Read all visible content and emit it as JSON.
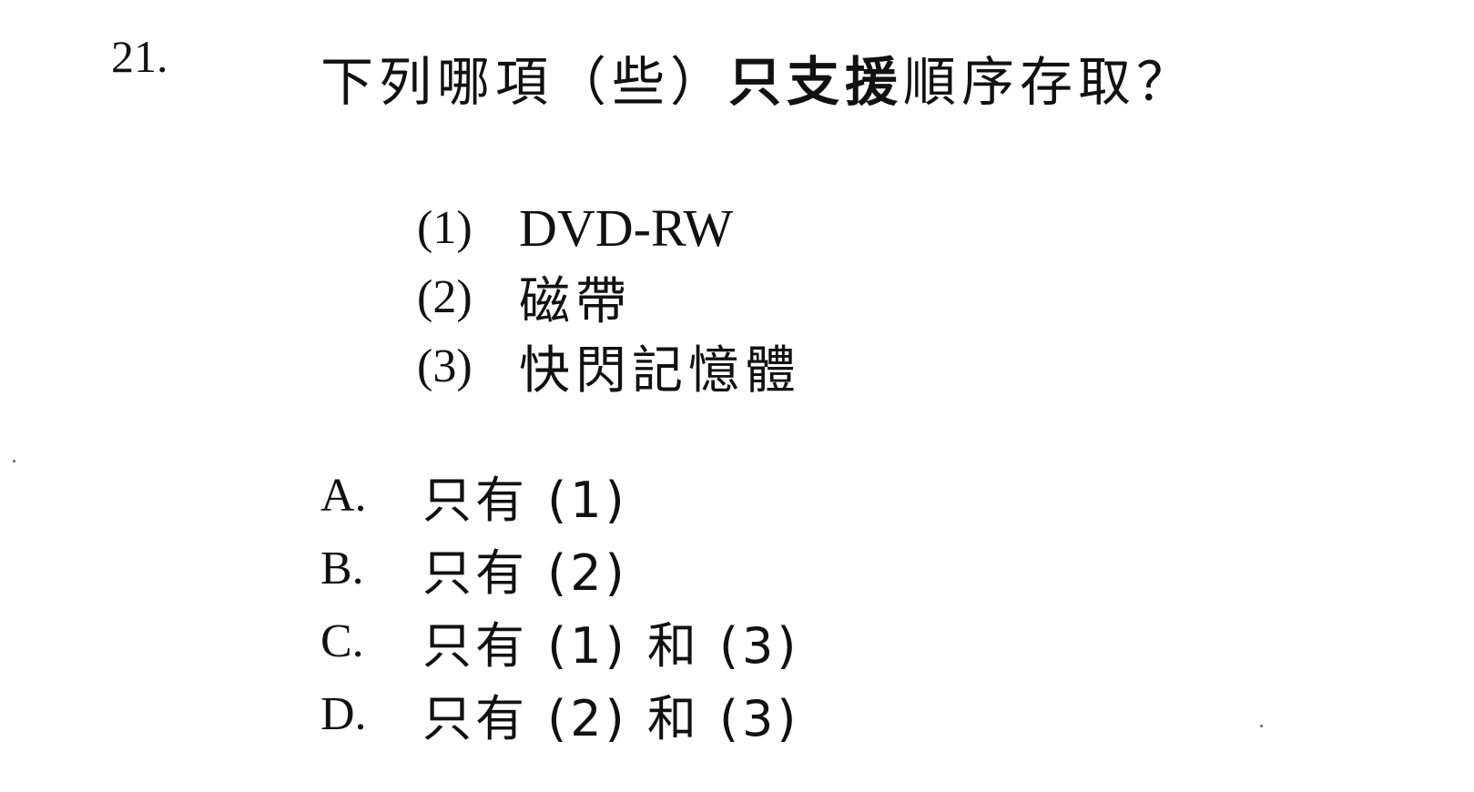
{
  "question": {
    "number": "21.",
    "stem_before": "下列哪項（些）",
    "stem_emphasis": "只支援",
    "stem_after": "順序存取？"
  },
  "items": [
    {
      "marker": "(1)",
      "text": "DVD-RW"
    },
    {
      "marker": "(2)",
      "text": "磁帶"
    },
    {
      "marker": "(3)",
      "text": "快閃記憶體"
    }
  ],
  "options": [
    {
      "letter": "A.",
      "text": "只有 (1)"
    },
    {
      "letter": "B.",
      "text": "只有 (2)"
    },
    {
      "letter": "C.",
      "text": "只有 (1) 和 (3)"
    },
    {
      "letter": "D.",
      "text": "只有 (2) 和 (3)"
    }
  ]
}
